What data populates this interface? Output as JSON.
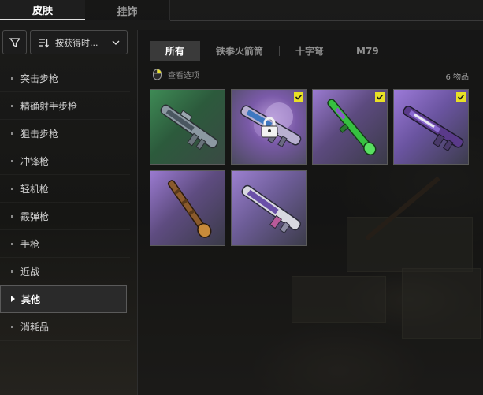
{
  "top_tabs": [
    {
      "label": "皮肤",
      "active": true
    },
    {
      "label": "挂饰",
      "active": false
    }
  ],
  "sort": {
    "label": "按获得时..."
  },
  "categories": [
    {
      "label": "突击步枪",
      "active": false
    },
    {
      "label": "精确射手步枪",
      "active": false
    },
    {
      "label": "狙击步枪",
      "active": false
    },
    {
      "label": "冲锋枪",
      "active": false
    },
    {
      "label": "轻机枪",
      "active": false
    },
    {
      "label": "霰弹枪",
      "active": false
    },
    {
      "label": "手枪",
      "active": false
    },
    {
      "label": "近战",
      "active": false
    },
    {
      "label": "其他",
      "active": true
    },
    {
      "label": "消耗品",
      "active": false
    }
  ],
  "sub_tabs": [
    {
      "label": "所有",
      "active": true
    },
    {
      "label": "铁拳火箭筒",
      "active": false
    },
    {
      "label": "十字弩",
      "active": false
    },
    {
      "label": "M79",
      "active": false
    }
  ],
  "view_options_label": "查看选项",
  "item_count": "6 物品",
  "items": [
    {
      "kind": "launcher",
      "bg": "green",
      "checked": false,
      "locked": false
    },
    {
      "kind": "launcher",
      "bg": "purple-smoke",
      "checked": true,
      "locked": true
    },
    {
      "kind": "rocket",
      "bg": "purple",
      "checked": true,
      "locked": false
    },
    {
      "kind": "crossbow",
      "bg": "purple",
      "checked": true,
      "locked": false
    },
    {
      "kind": "rocket",
      "bg": "purple",
      "checked": false,
      "locked": false
    },
    {
      "kind": "launcher",
      "bg": "purple",
      "checked": false,
      "locked": false
    }
  ],
  "colors": {
    "check": "#e8e026",
    "card_green": "#3b7a4a",
    "card_purple": "#8a6ab8"
  }
}
